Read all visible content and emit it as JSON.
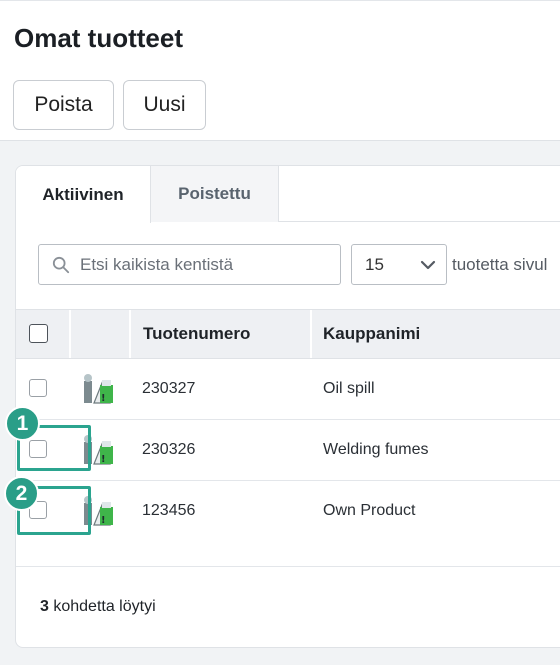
{
  "header": {
    "title": "Omat tuotteet",
    "delete_label": "Poista",
    "new_label": "Uusi"
  },
  "tabs": [
    {
      "label": "Aktiivinen",
      "active": true
    },
    {
      "label": "Poistettu",
      "active": false
    }
  ],
  "search": {
    "placeholder": "Etsi kaikista kentistä",
    "value": ""
  },
  "pagination": {
    "selected": "15",
    "suffix": "tuotetta sivul"
  },
  "table": {
    "columns": [
      "Tuotenumero",
      "Kauppanimi"
    ],
    "rows": [
      {
        "number": "230327",
        "name": "Oil spill"
      },
      {
        "number": "230326",
        "name": "Welding fumes"
      },
      {
        "number": "123456",
        "name": "Own Product"
      }
    ]
  },
  "footer": {
    "count": "3",
    "label": " kohdetta löytyi"
  },
  "callouts": [
    "1",
    "2"
  ],
  "colors": {
    "accent": "#2a9e88",
    "tab_inactive_bg": "#f4f5f7",
    "header_bg": "#eef0f3"
  }
}
